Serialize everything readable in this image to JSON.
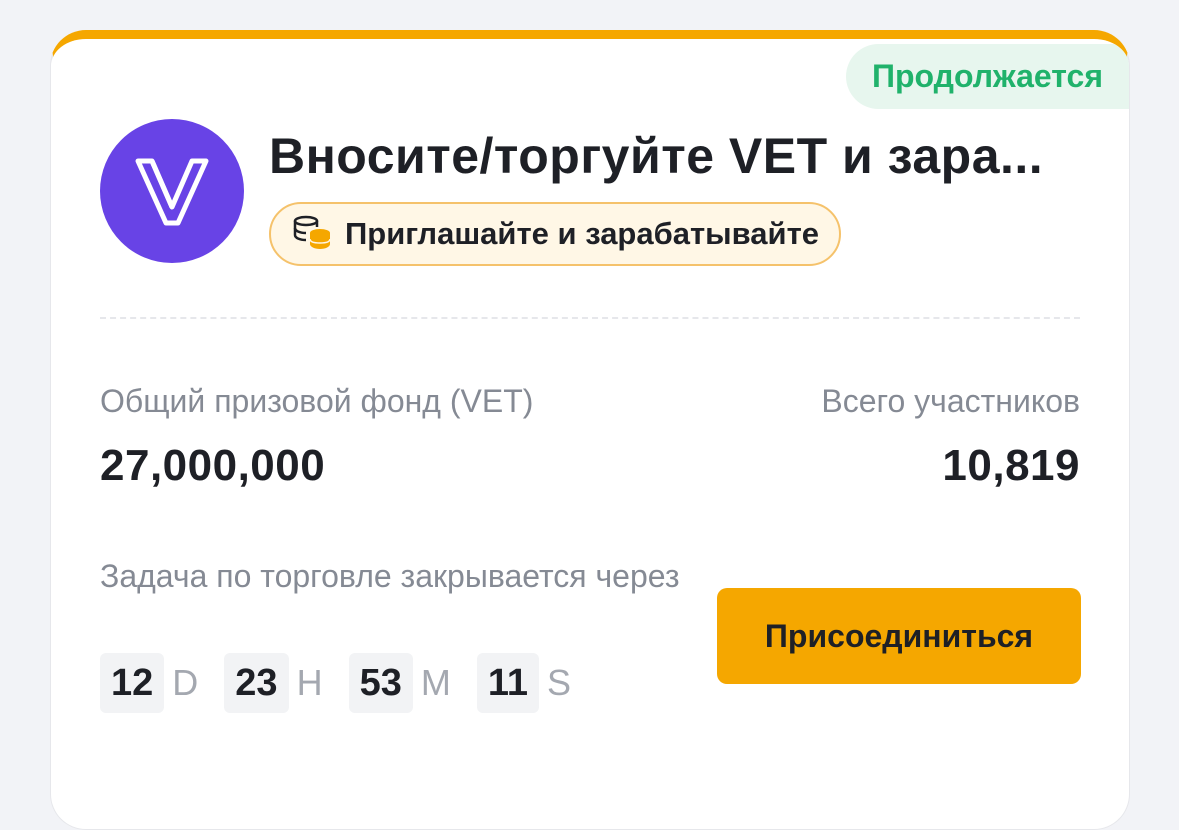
{
  "card": {
    "status": "Продолжается",
    "title": "Вносите/торгуйте VET и зара...",
    "tag": {
      "icon": "coins-stack-icon",
      "label": "Приглашайте и зарабатывайте"
    },
    "logo": {
      "icon": "vechain-v-logo",
      "color": "#6843e6"
    },
    "stats": {
      "prize_pool_label": "Общий призовой фонд (VET)",
      "prize_pool_value": "27,000,000",
      "participants_label": "Всего участников",
      "participants_value": "10,819"
    },
    "countdown": {
      "label": "Задача по торговле закрывается через",
      "days": "12",
      "days_unit": "D",
      "hours": "23",
      "hours_unit": "H",
      "minutes": "53",
      "minutes_unit": "M",
      "seconds": "11",
      "seconds_unit": "S"
    },
    "join_button": "Присоединиться"
  },
  "colors": {
    "accent": "#f5a700",
    "status_green": "#20b26b",
    "logo_purple": "#6843e6"
  }
}
